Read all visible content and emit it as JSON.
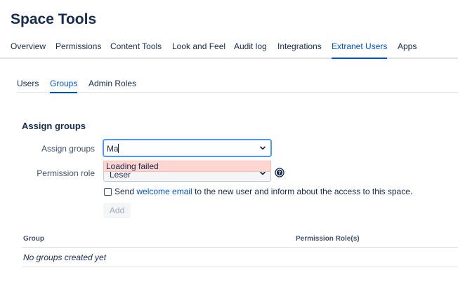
{
  "page": {
    "title": "Space Tools"
  },
  "tabs": [
    {
      "label": "Overview"
    },
    {
      "label": "Permissions"
    },
    {
      "label": "Content Tools"
    },
    {
      "label": "Look and Feel"
    },
    {
      "label": "Audit log"
    },
    {
      "label": "Integrations"
    },
    {
      "label": "Extranet Users",
      "active": true
    },
    {
      "label": "Apps"
    }
  ],
  "subtabs": [
    {
      "label": "Users"
    },
    {
      "label": "Groups",
      "active": true
    },
    {
      "label": "Admin Roles"
    }
  ],
  "form": {
    "section_title": "Assign groups",
    "assign_label": "Assign groups",
    "assign_value": "Ma",
    "dropdown_message": "Loading failed",
    "role_label": "Permission role",
    "role_value": "Leser",
    "send_prefix": "Send ",
    "send_link": "welcome email",
    "send_suffix": " to the new user and inform about the access to this space.",
    "add_label": "Add"
  },
  "table": {
    "headers": [
      "Group",
      "Permission Role(s)"
    ],
    "empty_message": "No groups created yet"
  },
  "colors": {
    "accent": "#0052cc",
    "error_bg": "#ffd5d2",
    "focus": "#4c9aff"
  }
}
